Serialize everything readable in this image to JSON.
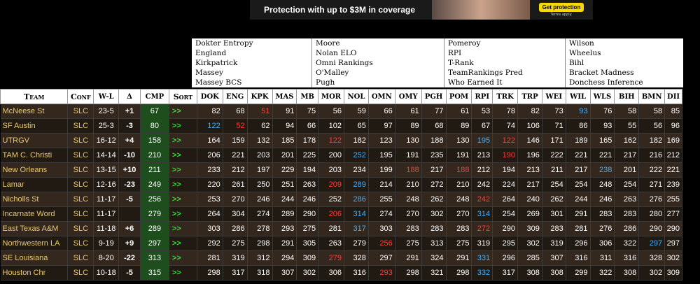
{
  "ad": {
    "text": "Protection with up to $3M in coverage",
    "cta": "Get protection",
    "terms": "Terms apply."
  },
  "sources": [
    [
      "Dokter Entropy",
      "England",
      "Kirkpatrick",
      "Massey",
      "Massey BCS"
    ],
    [
      "Moore",
      "Nolan ELO",
      "Omni Rankings",
      "O'Malley",
      "Pugh"
    ],
    [
      "Pomeroy",
      "RPI",
      "T-Rank",
      "TeamRankings Pred",
      "Who Earned It"
    ],
    [
      "Wilson",
      "Wheelus",
      "Bihl",
      "Bracket Madness",
      "Donchess Inference"
    ]
  ],
  "headers": [
    "Team",
    "Conf",
    "W-L",
    "Δ",
    "CMP",
    "Sort",
    "DOK",
    "ENG",
    "KPK",
    "MAS",
    "MB",
    "MOR",
    "NOL",
    "OMN",
    "OMY",
    "PGH",
    "POM",
    "RPI",
    "TRK",
    "TRP",
    "WEI",
    "WIL",
    "WLS",
    "BIH",
    "BMN",
    "DII"
  ],
  "colors": {
    "blue": "#3fb0ff",
    "red": "#ff3b3b",
    "green": "#55ee55",
    "cmp_bg": "#1e4e1e",
    "team": "#e8c870"
  },
  "rows": [
    {
      "team": "McNeese St",
      "conf": "SLC",
      "wl": "23-5",
      "delta": "+1",
      "cmp": "67",
      "sort": ">>",
      "ranks": [
        "82",
        "68",
        "51",
        "91",
        "75",
        "56",
        "59",
        "66",
        "61",
        "77",
        "61",
        "53",
        "78",
        "82",
        "73",
        "93",
        "76",
        "58",
        "58",
        "85"
      ],
      "hl": {
        "2": "red",
        "15": "blue"
      }
    },
    {
      "team": "SF Austin",
      "conf": "SLC",
      "wl": "25-3",
      "delta": "-3",
      "cmp": "80",
      "sort": ">>",
      "ranks": [
        "122",
        "52",
        "62",
        "94",
        "66",
        "102",
        "65",
        "97",
        "89",
        "68",
        "89",
        "67",
        "74",
        "106",
        "71",
        "86",
        "93",
        "55",
        "56",
        "96"
      ],
      "hl": {
        "0": "blue",
        "1": "red"
      }
    },
    {
      "team": "UTRGV",
      "conf": "SLC",
      "wl": "16-12",
      "delta": "+4",
      "cmp": "158",
      "sort": ">>",
      "ranks": [
        "164",
        "159",
        "132",
        "185",
        "178",
        "122",
        "182",
        "123",
        "130",
        "188",
        "130",
        "195",
        "122",
        "146",
        "171",
        "189",
        "165",
        "162",
        "182",
        "169"
      ],
      "hl": {
        "5": "red",
        "11": "blue",
        "12": "red"
      }
    },
    {
      "team": "TAM C. Christi",
      "conf": "SLC",
      "wl": "14-14",
      "delta": "-10",
      "cmp": "210",
      "sort": ">>",
      "ranks": [
        "206",
        "221",
        "203",
        "201",
        "225",
        "200",
        "252",
        "195",
        "191",
        "235",
        "191",
        "213",
        "190",
        "196",
        "222",
        "221",
        "221",
        "217",
        "216",
        "212"
      ],
      "hl": {
        "6": "blue",
        "12": "red"
      }
    },
    {
      "team": "New Orleans",
      "conf": "SLC",
      "wl": "13-15",
      "delta": "+10",
      "cmp": "211",
      "sort": ">>",
      "ranks": [
        "233",
        "212",
        "197",
        "229",
        "194",
        "203",
        "234",
        "199",
        "188",
        "217",
        "188",
        "212",
        "194",
        "213",
        "211",
        "217",
        "238",
        "201",
        "222",
        "221"
      ],
      "hl": {
        "8": "red",
        "10": "red",
        "16": "blue"
      }
    },
    {
      "team": "Lamar",
      "conf": "SLC",
      "wl": "12-16",
      "delta": "-23",
      "cmp": "249",
      "sort": ">>",
      "ranks": [
        "220",
        "261",
        "250",
        "251",
        "263",
        "209",
        "289",
        "214",
        "210",
        "272",
        "210",
        "242",
        "224",
        "217",
        "254",
        "254",
        "248",
        "254",
        "271",
        "239"
      ],
      "hl": {
        "5": "red",
        "6": "blue"
      }
    },
    {
      "team": "Nicholls St",
      "conf": "SLC",
      "wl": "11-17",
      "delta": "-5",
      "cmp": "256",
      "sort": ">>",
      "ranks": [
        "253",
        "270",
        "246",
        "244",
        "246",
        "252",
        "286",
        "255",
        "248",
        "262",
        "248",
        "242",
        "264",
        "240",
        "262",
        "244",
        "246",
        "263",
        "276",
        "255"
      ],
      "hl": {
        "6": "blue",
        "11": "red"
      }
    },
    {
      "team": "Incarnate Word",
      "conf": "SLC",
      "wl": "11-17",
      "delta": "",
      "cmp": "279",
      "sort": ">>",
      "ranks": [
        "264",
        "304",
        "274",
        "289",
        "290",
        "206",
        "314",
        "274",
        "270",
        "302",
        "270",
        "314",
        "254",
        "269",
        "301",
        "291",
        "283",
        "283",
        "280",
        "277"
      ],
      "hl": {
        "5": "red",
        "6": "blue",
        "11": "blue"
      }
    },
    {
      "team": "East Texas A&M",
      "conf": "SLC",
      "wl": "11-18",
      "delta": "+6",
      "cmp": "289",
      "sort": ">>",
      "ranks": [
        "303",
        "286",
        "278",
        "293",
        "275",
        "281",
        "317",
        "303",
        "283",
        "283",
        "283",
        "272",
        "290",
        "309",
        "283",
        "281",
        "276",
        "286",
        "290",
        "290"
      ],
      "hl": {
        "6": "blue",
        "11": "red"
      }
    },
    {
      "team": "Northwestern LA",
      "conf": "SLC",
      "wl": "9-19",
      "delta": "+9",
      "cmp": "297",
      "sort": ">>",
      "ranks": [
        "292",
        "275",
        "298",
        "291",
        "305",
        "263",
        "279",
        "256",
        "275",
        "313",
        "275",
        "319",
        "295",
        "302",
        "319",
        "296",
        "306",
        "322",
        "297",
        "297"
      ],
      "hl": {
        "7": "red",
        "18": "blue"
      }
    },
    {
      "team": "SE Louisiana",
      "conf": "SLC",
      "wl": "8-20",
      "delta": "-22",
      "cmp": "313",
      "sort": ">>",
      "ranks": [
        "281",
        "319",
        "312",
        "294",
        "309",
        "279",
        "328",
        "297",
        "291",
        "324",
        "291",
        "331",
        "296",
        "285",
        "307",
        "316",
        "311",
        "316",
        "328",
        "302"
      ],
      "hl": {
        "5": "red",
        "11": "blue"
      }
    },
    {
      "team": "Houston Chr",
      "conf": "SLC",
      "wl": "10-18",
      "delta": "-5",
      "cmp": "315",
      "sort": ">>",
      "ranks": [
        "298",
        "317",
        "318",
        "307",
        "302",
        "306",
        "316",
        "293",
        "298",
        "321",
        "298",
        "332",
        "317",
        "308",
        "308",
        "299",
        "322",
        "308",
        "302",
        "309"
      ],
      "hl": {
        "7": "red",
        "11": "blue"
      }
    }
  ]
}
